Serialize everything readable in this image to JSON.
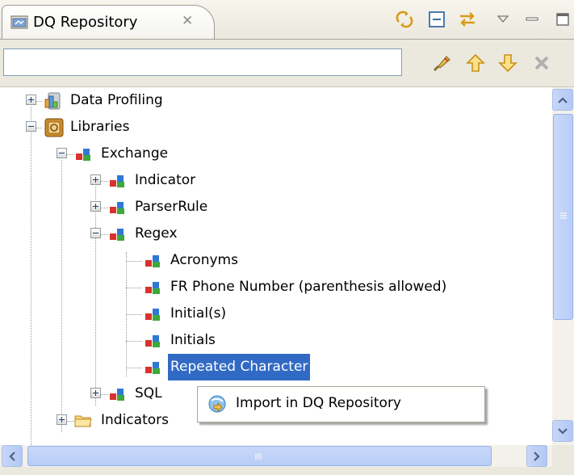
{
  "view": {
    "title": "DQ Repository",
    "close_glyph": "✕",
    "toolbar_icons": [
      "link-with-editor-icon",
      "collapse-all-icon",
      "refresh-icon",
      "view-menu-icon",
      "minimize-icon",
      "maximize-icon"
    ]
  },
  "filter": {
    "value": "",
    "placeholder": "",
    "buttons": [
      "clear-filter-icon",
      "move-up-icon",
      "move-down-icon",
      "remove-icon"
    ]
  },
  "tree": {
    "nodes": [
      {
        "label": "Data Profiling",
        "icon": "data-profiling-icon",
        "expander": "plus"
      },
      {
        "label": "Libraries",
        "icon": "libraries-icon",
        "expander": "minus"
      },
      {
        "label": "Exchange",
        "icon": "exchange-icon",
        "expander": "minus"
      },
      {
        "label": "Indicator",
        "icon": "exchange-folder-icon",
        "expander": "plus"
      },
      {
        "label": "ParserRule",
        "icon": "exchange-folder-icon",
        "expander": "plus"
      },
      {
        "label": "Regex",
        "icon": "exchange-folder-icon",
        "expander": "minus"
      },
      {
        "label": "Acronyms",
        "icon": "exchange-item-icon",
        "expander": ""
      },
      {
        "label": "FR Phone Number (parenthesis allowed)",
        "icon": "exchange-item-icon",
        "expander": ""
      },
      {
        "label": "Initial(s)",
        "icon": "exchange-item-icon",
        "expander": ""
      },
      {
        "label": "Initials",
        "icon": "exchange-item-icon",
        "expander": ""
      },
      {
        "label": "Repeated Character",
        "icon": "exchange-item-icon",
        "expander": "",
        "selected": true
      },
      {
        "label": "SQL",
        "icon": "exchange-folder-icon",
        "expander": "plus"
      },
      {
        "label": "Indicators",
        "icon": "folder-icon",
        "expander": "plus"
      }
    ]
  },
  "context_menu": {
    "items": [
      {
        "label": "Import in DQ Repository",
        "icon": "import-icon"
      }
    ]
  },
  "colors": {
    "selection": "#316ac5",
    "scrollbar": "#b8cdf6",
    "chrome": "#ebe9de"
  }
}
